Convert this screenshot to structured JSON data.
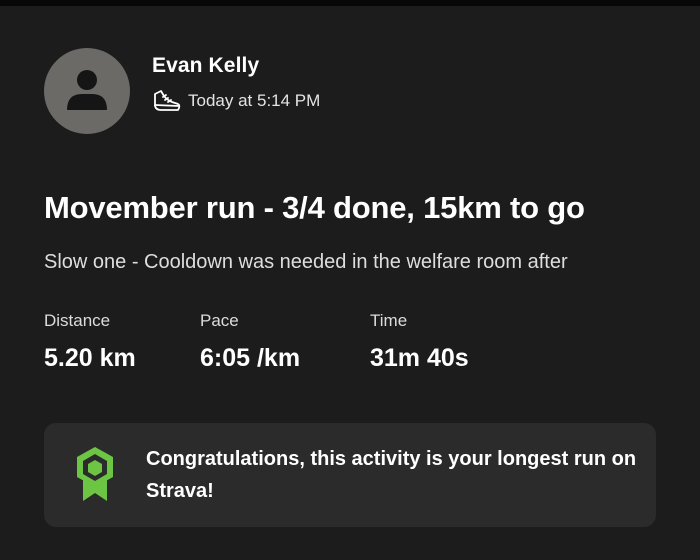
{
  "activity": {
    "athlete_name": "Evan Kelly",
    "activity_type_icon": "running-shoe-icon",
    "timestamp": "Today at 5:14 PM",
    "title": "Movember run - 3/4 done, 15km to go",
    "description": "Slow one - Cooldown was needed in the welfare room after",
    "stats": {
      "distance": {
        "label": "Distance",
        "value": "5.20 km"
      },
      "pace": {
        "label": "Pace",
        "value": "6:05 /km"
      },
      "time": {
        "label": "Time",
        "value": "31m 40s"
      }
    },
    "achievement": {
      "icon": "achievement-badge-icon",
      "text": "Congratulations, this activity is your longest run on Strava!"
    }
  },
  "colors": {
    "background": "#1c1c1c",
    "avatar": "#6b6a67",
    "achievement_card": "#2b2b2b",
    "badge_green": "#6cc644"
  }
}
